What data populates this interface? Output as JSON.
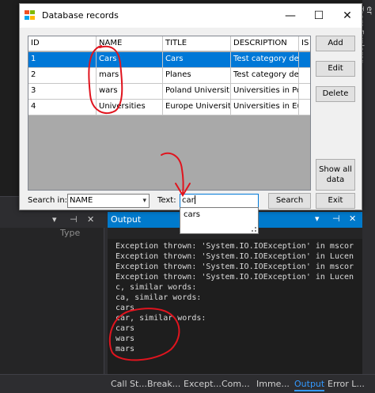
{
  "vs": {
    "right_strip_items": [
      "Team Explorer"
    ],
    "right_strip_fragment": "er",
    "left_pane_type_label": "Type"
  },
  "dialog": {
    "title": "Database records",
    "titlebar_buttons": {
      "minimize": "—",
      "maximize": "☐",
      "close": "✕"
    },
    "grid": {
      "columns": [
        "ID",
        "NAME",
        "TITLE",
        "DESCRIPTION",
        "IS"
      ],
      "rows": [
        {
          "id": "1",
          "name": "Cars",
          "title": "Cars",
          "description": "Test category de...",
          "selected": true
        },
        {
          "id": "2",
          "name": "mars",
          "title": "Planes",
          "description": "Test category de...",
          "selected": false
        },
        {
          "id": "3",
          "name": "wars",
          "title": "Poland Universities",
          "description": "Universities in Pol...",
          "selected": false
        },
        {
          "id": "4",
          "name": "Universities",
          "title": "Europe Universities",
          "description": "Universities in Eu...",
          "selected": false
        }
      ]
    },
    "buttons": {
      "add": "Add",
      "edit": "Edit",
      "delete": "Delete",
      "show_all": "Show all data",
      "search": "Search",
      "exit": "Exit"
    },
    "search_in_label": "Search in:",
    "search_in_value": "NAME",
    "text_label": "Text:",
    "text_value": "car",
    "suggestion": "cars"
  },
  "output": {
    "title": "Output",
    "controls": {
      "dropdown": "▾",
      "pin": "⊣",
      "close": "✕"
    },
    "lines": [
      "Exception thrown: 'System.IO.IOException' in mscor",
      "Exception thrown: 'System.IO.IOException' in Lucen",
      "Exception thrown: 'System.IO.IOException' in mscor",
      "Exception thrown: 'System.IO.IOException' in Lucen",
      "c, similar words:",
      "ca, similar words:",
      "cars",
      "car, similar words:",
      "cars",
      "wars",
      "mars"
    ]
  },
  "left_pane": {
    "controls": {
      "dropdown": "▾",
      "pin": "⊣",
      "close": "✕"
    }
  },
  "bottom_tabs": [
    {
      "label": "Call St...",
      "active": false
    },
    {
      "label": "Break...",
      "active": false
    },
    {
      "label": "Except...",
      "active": false
    },
    {
      "label": "Com...",
      "active": false
    },
    {
      "label": "Imme...",
      "active": false
    },
    {
      "label": "Output",
      "active": true
    },
    {
      "label": "Error L...",
      "active": false
    }
  ],
  "colors": {
    "accent": "#007acc",
    "selection": "#0078d7",
    "annotation": "#e0141e"
  }
}
